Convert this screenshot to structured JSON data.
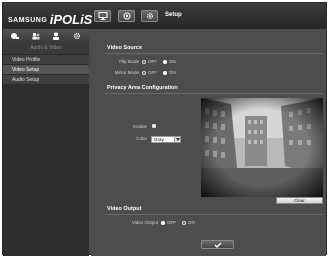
{
  "header": {
    "logo_prefix": "SAMSUNG",
    "logo_brand": "iPOLiS",
    "page_title": "Setup",
    "buttons": [
      "monitor-icon",
      "camera-lens-icon",
      "gear-icon"
    ]
  },
  "sidebar": {
    "icons": [
      "camera-icon",
      "users-icon",
      "person-icon",
      "gear-icon"
    ],
    "heading": "Audio & Video",
    "items": [
      {
        "label": "Video Profile",
        "active": false
      },
      {
        "label": "Video Setup",
        "active": true
      },
      {
        "label": "Audio Setup",
        "active": false
      }
    ]
  },
  "video_source": {
    "title": "Video Source",
    "flip_mode": {
      "label": "Flip Mode",
      "off": "OFF",
      "on": "ON",
      "selected": "ON"
    },
    "mirror_mode": {
      "label": "Mirror Mode",
      "off": "OFF",
      "on": "ON",
      "selected": "ON"
    }
  },
  "privacy": {
    "title": "Privacy Area Configuration",
    "enable_label": "Enable",
    "color_label": "Color",
    "color_value": "Gray",
    "clear_label": "Clear"
  },
  "video_output": {
    "title": "Video Output",
    "label": "Video Output",
    "off": "OFF",
    "on": "ON",
    "selected": "OFF"
  },
  "apply": {
    "icon": "checkmark-icon"
  },
  "colors": {
    "main_bg": "#4d4d4d",
    "sidebar_bg": "#2e2e2e",
    "topbar_bg": "#262626"
  }
}
